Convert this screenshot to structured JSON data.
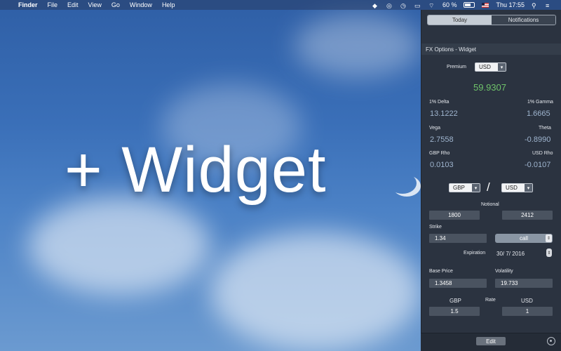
{
  "menubar": {
    "app": "Finder",
    "items": [
      "File",
      "Edit",
      "View",
      "Go",
      "Window",
      "Help"
    ],
    "battery": "60 %",
    "clock": "Thu 17:55",
    "icons": [
      "dropbox-icon",
      "creative-cloud-icon",
      "timemachine-icon",
      "airplay-icon",
      "wifi-icon",
      "battery-icon",
      "flag-icon",
      "search-icon",
      "list-icon"
    ]
  },
  "desktop": {
    "big_text": "+ Widget"
  },
  "panel": {
    "tabs": [
      "Today",
      "Notifications"
    ],
    "active_tab": "Today",
    "widget_title": "FX Options - Widget",
    "premium_label": "Premium",
    "premium_currency": "USD",
    "premium_value": "59.9307",
    "greeks": {
      "delta_label": "1% Delta",
      "delta": "13.1222",
      "gamma_label": "1% Gamma",
      "gamma": "1.6665",
      "vega_label": "Vega",
      "vega": "2.7558",
      "theta_label": "Theta",
      "theta": "-0.8990",
      "gbp_rho_label": "GBP Rho",
      "gbp_rho": "0.0103",
      "usd_rho_label": "USD Rho",
      "usd_rho": "-0.0107"
    },
    "pair": {
      "base": "GBP",
      "quote": "USD",
      "separator": "/"
    },
    "notional_label": "Notional",
    "notional_base": "1800",
    "notional_quote": "2412",
    "strike_label": "Strike",
    "strike": "1.34",
    "option_type": "call",
    "expiration_label": "Expiration",
    "expiration": "30/  7/ 2016",
    "base_price_label": "Base Price",
    "base_price": "1.3458",
    "volatility_label": "Volatility",
    "volatility": "19.733",
    "gbp_label": "GBP",
    "rate_label": "Rate",
    "usd_label": "USD",
    "gbp_rate": "1.5",
    "usd_rate": "1",
    "edit_label": "Edit"
  },
  "colors": {
    "accent_green": "#6fc36a",
    "value_blue": "#9fb5cf",
    "panel_bg": "#2b3340"
  }
}
